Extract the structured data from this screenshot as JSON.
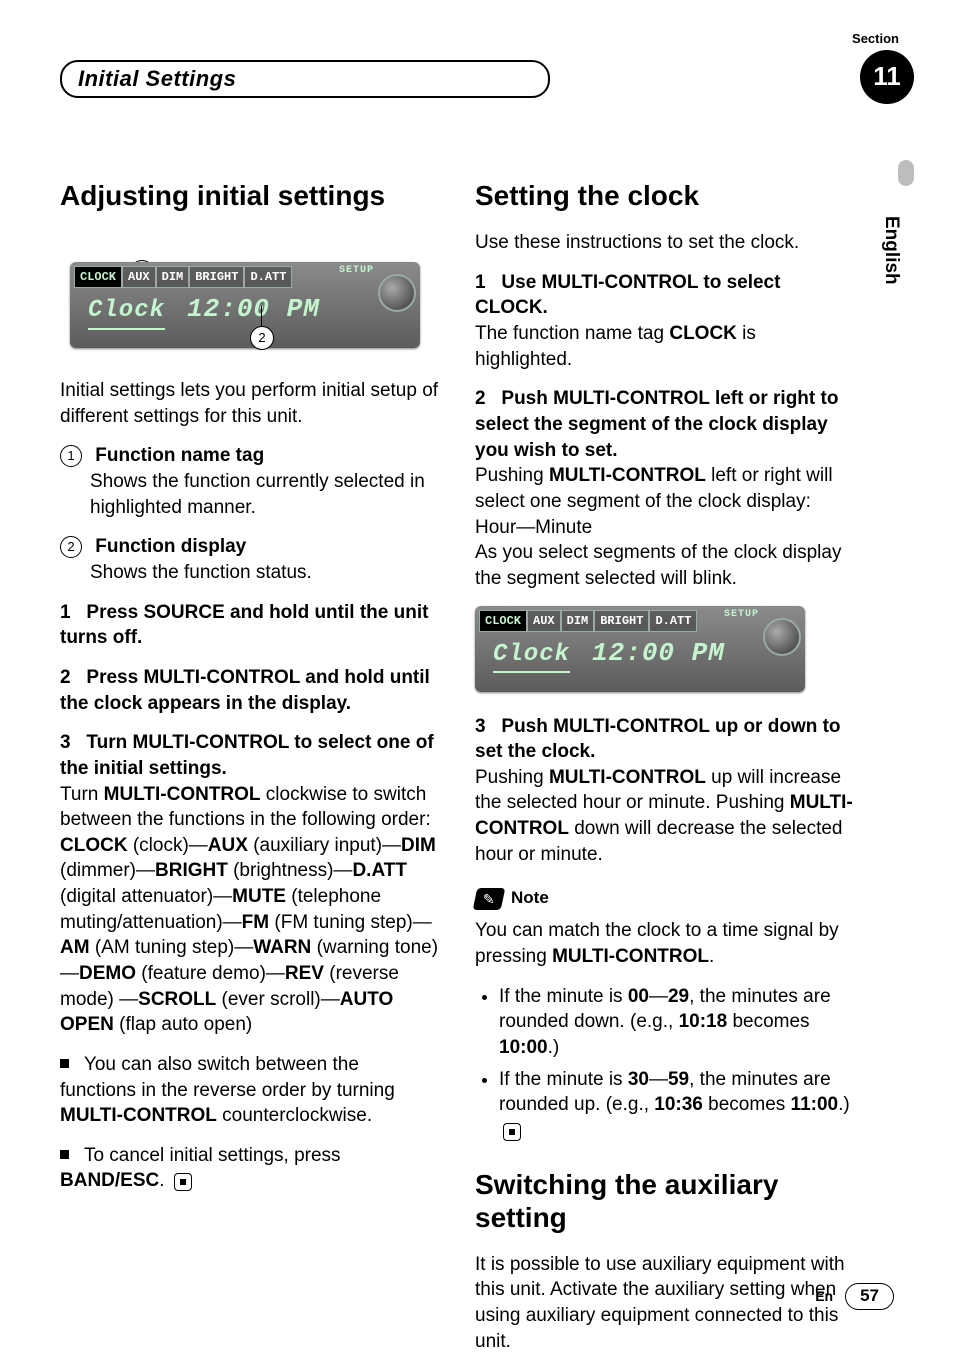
{
  "section": {
    "label": "Section",
    "number": "11",
    "title": "Initial Settings"
  },
  "language_tab": "English",
  "footer": {
    "lang_code": "En",
    "page": "57"
  },
  "lcd": {
    "setup_tag": "SETUP",
    "tabs": [
      "CLOCK",
      "AUX",
      "DIM",
      "BRIGHT",
      "D.ATT"
    ],
    "selected_tab_index": 0,
    "fn": "Clock",
    "value": "12:00 PM"
  },
  "left": {
    "h": "Adjusting initial settings",
    "intro": "Initial settings lets you perform initial setup of different settings for this unit.",
    "item1_title": "Function name tag",
    "item1_body": "Shows the function currently selected in highlighted manner.",
    "item2_title": "Function display",
    "item2_body": "Shows the function status.",
    "s1": "Press SOURCE and hold until the unit turns off.",
    "s2": "Press MULTI-CONTROL and hold until the clock appears in the display.",
    "s3": "Turn MULTI-CONTROL to select one of the initial settings.",
    "s3_body_a": "Turn ",
    "s3_mc": "MULTI-CONTROL",
    "s3_body_b": " clockwise to switch between the functions in the following order:",
    "order_parts": {
      "CLOCK": "CLOCK",
      "clock_p": " (clock)—",
      "AUX": "AUX",
      "aux_p": " (auxiliary input)—",
      "DIM": "DIM",
      "dim_p": " (dimmer)—",
      "BRIGHT": "BRIGHT",
      "bright_p": " (brightness)—",
      "DATT": "D.ATT",
      "datt_p": " (digital attenuator)—",
      "MUTE": "MUTE",
      "mute_p": " (telephone muting/attenuation)—",
      "FM": "FM",
      "fm_p": " (FM tuning step)—",
      "AM": "AM",
      "am_p": " (AM tuning step)—",
      "WARN": "WARN",
      "warn_p": " (warning tone)—",
      "DEMO": "DEMO",
      "demo_p": " (feature demo)—",
      "REV": "REV",
      "rev_p": " (reverse mode) —",
      "SCROLL": "SCROLL",
      "scroll_p": " (ever scroll)—",
      "AUTO": "AUTO OPEN",
      "auto_p": " (flap auto open)"
    },
    "tip1_a": "You can also switch between the functions in the reverse order by turning ",
    "tip1_b": " counterclockwise.",
    "tip2_a": "To cancel initial settings, press ",
    "tip2_key": "BAND/ESC",
    "tip2_b": "."
  },
  "right": {
    "h_clock": "Setting the clock",
    "intro": "Use these instructions to set the clock.",
    "s1_head": "Use MULTI-CONTROL to select CLOCK.",
    "s1_body_a": "The function name tag ",
    "s1_key": "CLOCK",
    "s1_body_b": " is highlighted.",
    "s2_head": "Push MULTI-CONTROL left or right to select the segment of the clock display you wish to set.",
    "s2_body_a": "Pushing ",
    "s2_key": "MULTI-CONTROL",
    "s2_body_b": " left or right will select one segment of the clock display:",
    "s2_seg": "Hour—Minute",
    "s2_tail": "As you select segments of the clock display the segment selected will blink.",
    "s3_head": "Push MULTI-CONTROL up or down to set the clock.",
    "s3_body_a": "Pushing ",
    "s3_key1": "MULTI-CONTROL",
    "s3_body_b": " up will increase the selected hour or minute. Pushing ",
    "s3_key2": "MULTI-CONTROL",
    "s3_body_c": " down will decrease the selected hour or minute.",
    "note_label": "Note",
    "note_intro_a": "You can match the clock to a time signal by pressing ",
    "note_key": "MULTI-CONTROL",
    "note_intro_b": ".",
    "n1_a": "If the minute is ",
    "n1_r1": "00",
    "n1_dash": "—",
    "n1_r2": "29",
    "n1_b": ", the minutes are rounded down. (e.g., ",
    "n1_ex1": "10:18",
    "n1_c": " becomes ",
    "n1_ex2": "10:00",
    "n1_d": ".)",
    "n2_a": "If the minute is ",
    "n2_r1": "30",
    "n2_r2": "59",
    "n2_b": ", the minutes are rounded up. (e.g., ",
    "n2_ex1": "10:36",
    "n2_c": " becomes ",
    "n2_ex2": "11:00",
    "n2_d": ".)",
    "h_aux": "Switching the auxiliary setting",
    "aux_body": "It is possible to use auxiliary equipment with this unit. Activate the auxiliary setting when using auxiliary equipment connected to this unit."
  }
}
